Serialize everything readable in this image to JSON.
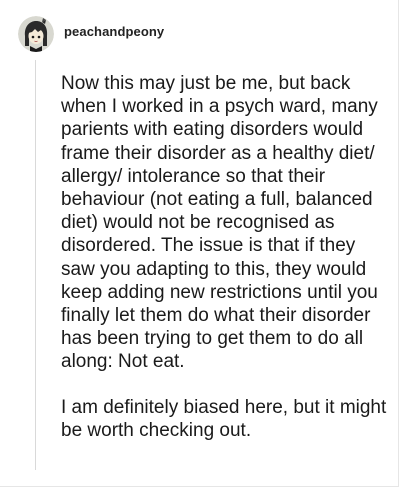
{
  "post": {
    "username": "peachandpeony",
    "avatar_icon": "avatar-cartoon-girl-icon",
    "paragraphs": [
      "Now this may just be me, but back when I worked in a psych ward, many parients with eating disorders would frame their disorder as a healthy diet/ allergy/ intolerance so that their behaviour (not eating a full, balanced diet) would not be recognised as disordered. The issue is that if they saw you adapting to this, they would keep adding new restrictions until you finally let them do what their disorder has been trying to get them to do all along: Not eat.",
      "I am definitely biased here, but it might be worth checking out."
    ]
  },
  "colors": {
    "text": "#1a1a1a",
    "username": "#222222",
    "divider": "#d9d9d9",
    "background": "#ffffff"
  }
}
